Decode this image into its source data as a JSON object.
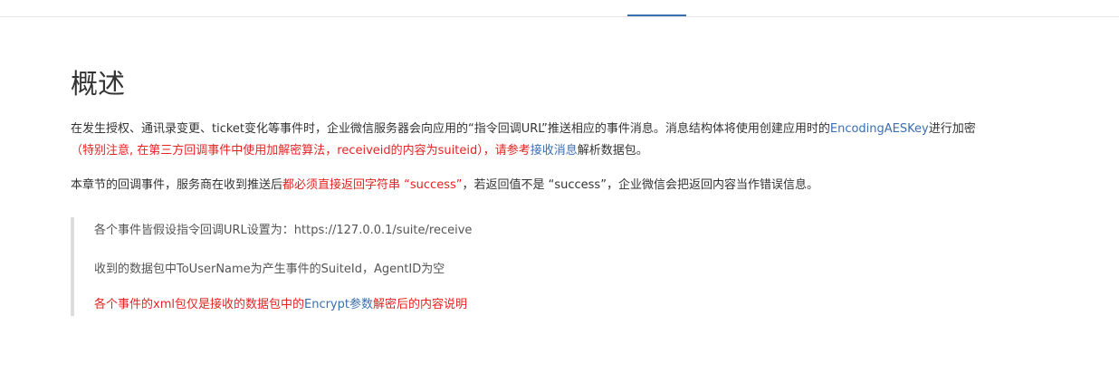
{
  "page": {
    "title": "概述"
  },
  "paragraph1": {
    "text_a": "在发生授权、通讯录变更、ticket变化等事件时，企业微信服务器会向应用的“指令回调URL”推送相应的事件消息。消息结构体将使用创建应用时的",
    "link_encoding": "EncodingAESKey",
    "text_b": "进行加密",
    "paren_open": "（",
    "red_note": "特别注意, 在第三方回调事件中使用加解密算法，receiveid的内容为suiteid",
    "paren_close": "），请参考",
    "link_receive": "接收消息",
    "text_c": "解析数据包。"
  },
  "paragraph2": {
    "text_a": "本章节的回调事件，服务商在收到推送后",
    "red_text": "都必须直接返回字符串 “success”",
    "text_b": "，若返回值不是 “success”，企业微信会把返回内容当作错误信息。"
  },
  "blockquote": {
    "line1": "各个事件皆假设指令回调URL设置为：https://127.0.0.1/suite/receive",
    "line2": "收到的数据包中ToUserName为产生事件的SuiteId，AgentID为空",
    "line3_a": "各个事件的xml包仅是接收的数据包中的",
    "line3_link": "Encrypt参数",
    "line3_b": "解密后的内容说明"
  },
  "colors": {
    "accent": "#3a6fb0",
    "red": "#e62222",
    "text": "#333333"
  }
}
